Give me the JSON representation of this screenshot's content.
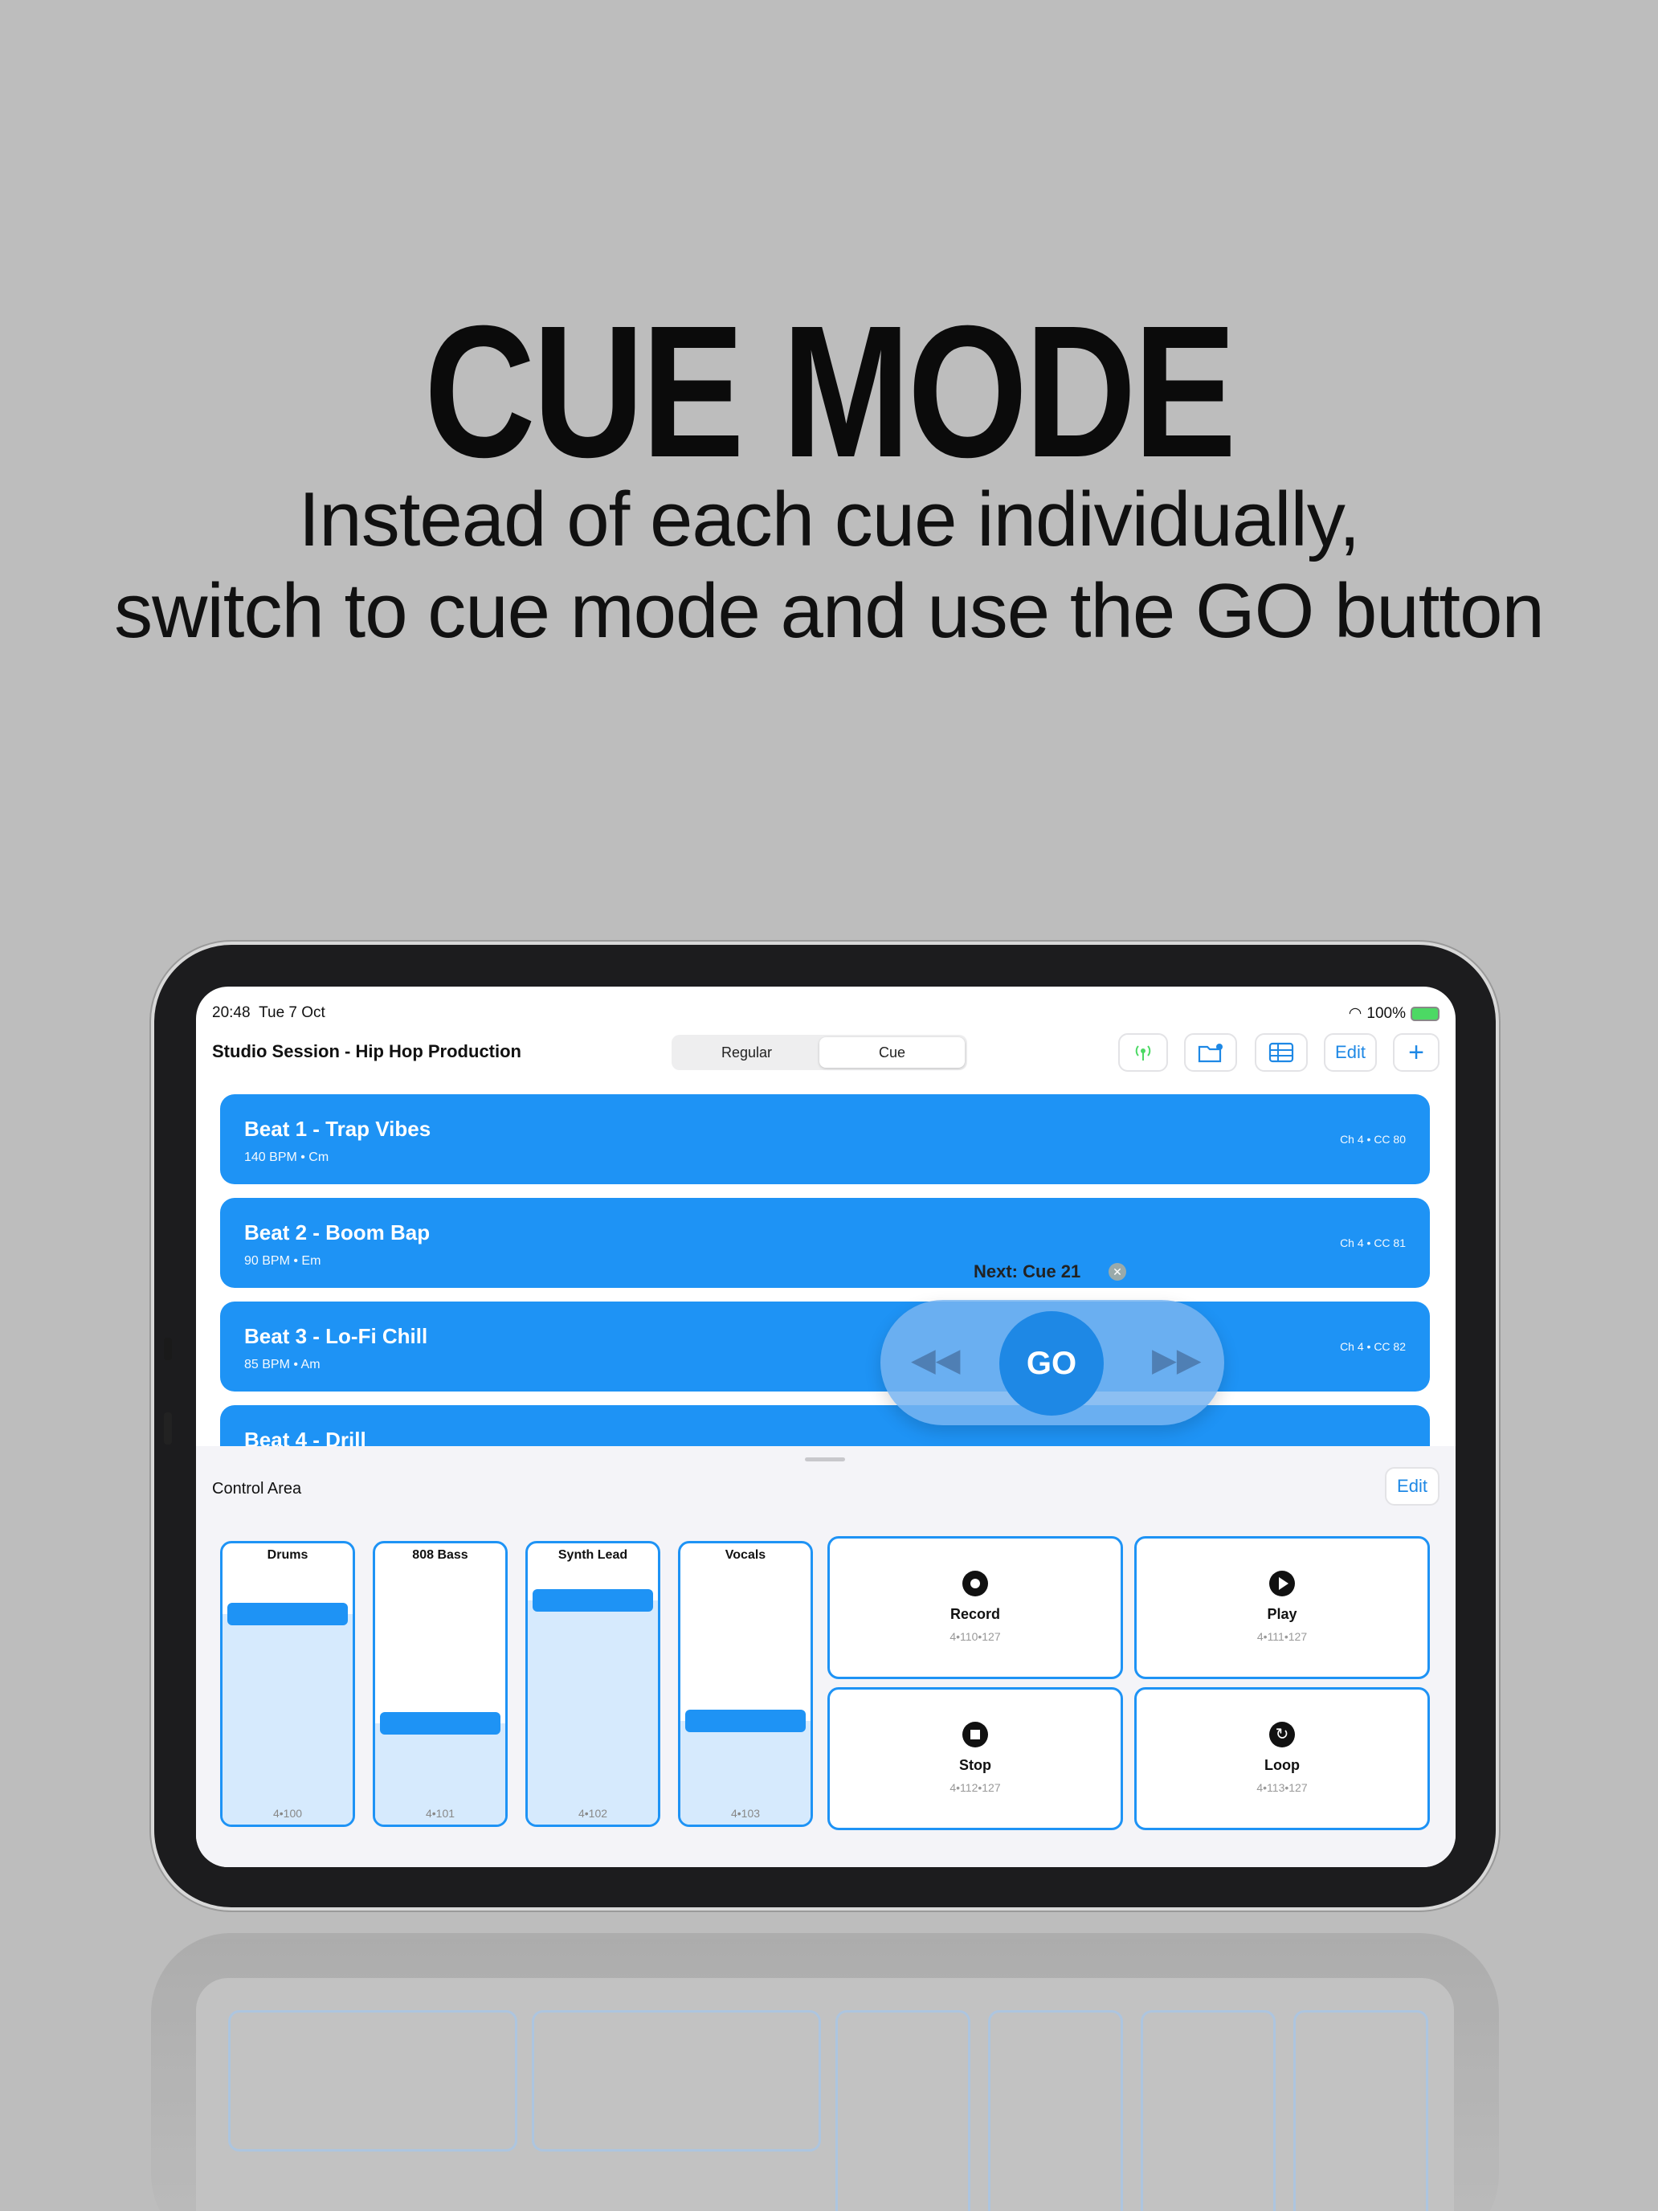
{
  "headline": "CUE MODE",
  "subtitle_line1": "Instead of each cue individually,",
  "subtitle_line2": "switch to cue mode and use the GO button",
  "status": {
    "time": "20:48",
    "date": "Tue 7 Oct",
    "battery": "100%"
  },
  "nav": {
    "title": "Studio Session - Hip Hop Production",
    "seg_regular": "Regular",
    "seg_cue": "Cue",
    "edit": "Edit",
    "add": "+"
  },
  "cues": [
    {
      "name": "Beat 1 - Trap Vibes",
      "meta": "140 BPM • Cm",
      "cc": "Ch 4  •  CC 80"
    },
    {
      "name": "Beat 2 - Boom Bap",
      "meta": "90 BPM • Em",
      "cc": "Ch 4  •  CC 81"
    },
    {
      "name": "Beat 3 - Lo-Fi Chill",
      "meta": "85 BPM • Am",
      "cc": "Ch 4  •  CC 82"
    },
    {
      "name": "Beat 4 - Drill"
    }
  ],
  "next_label": "Next: Cue 21",
  "go_label": "GO",
  "control": {
    "title": "Control Area",
    "edit": "Edit"
  },
  "faders": [
    {
      "label": "Drums",
      "cc": "4•100",
      "level": 0.8
    },
    {
      "label": "808 Bass",
      "cc": "4•101",
      "level": 0.33
    },
    {
      "label": "Synth Lead",
      "cc": "4•102",
      "level": 0.86
    },
    {
      "label": "Vocals",
      "cc": "4•103",
      "level": 0.34
    }
  ],
  "pads": [
    {
      "label": "Record",
      "cc": "4•110•127",
      "icon": "record-icon"
    },
    {
      "label": "Play",
      "cc": "4•111•127",
      "icon": "play-icon"
    },
    {
      "label": "Stop",
      "cc": "4•112•127",
      "icon": "stop-icon"
    },
    {
      "label": "Loop",
      "cc": "4•113•127",
      "icon": "loop-icon"
    }
  ],
  "colors": {
    "accent": "#1e93f5",
    "background": "#bdbdbd"
  }
}
